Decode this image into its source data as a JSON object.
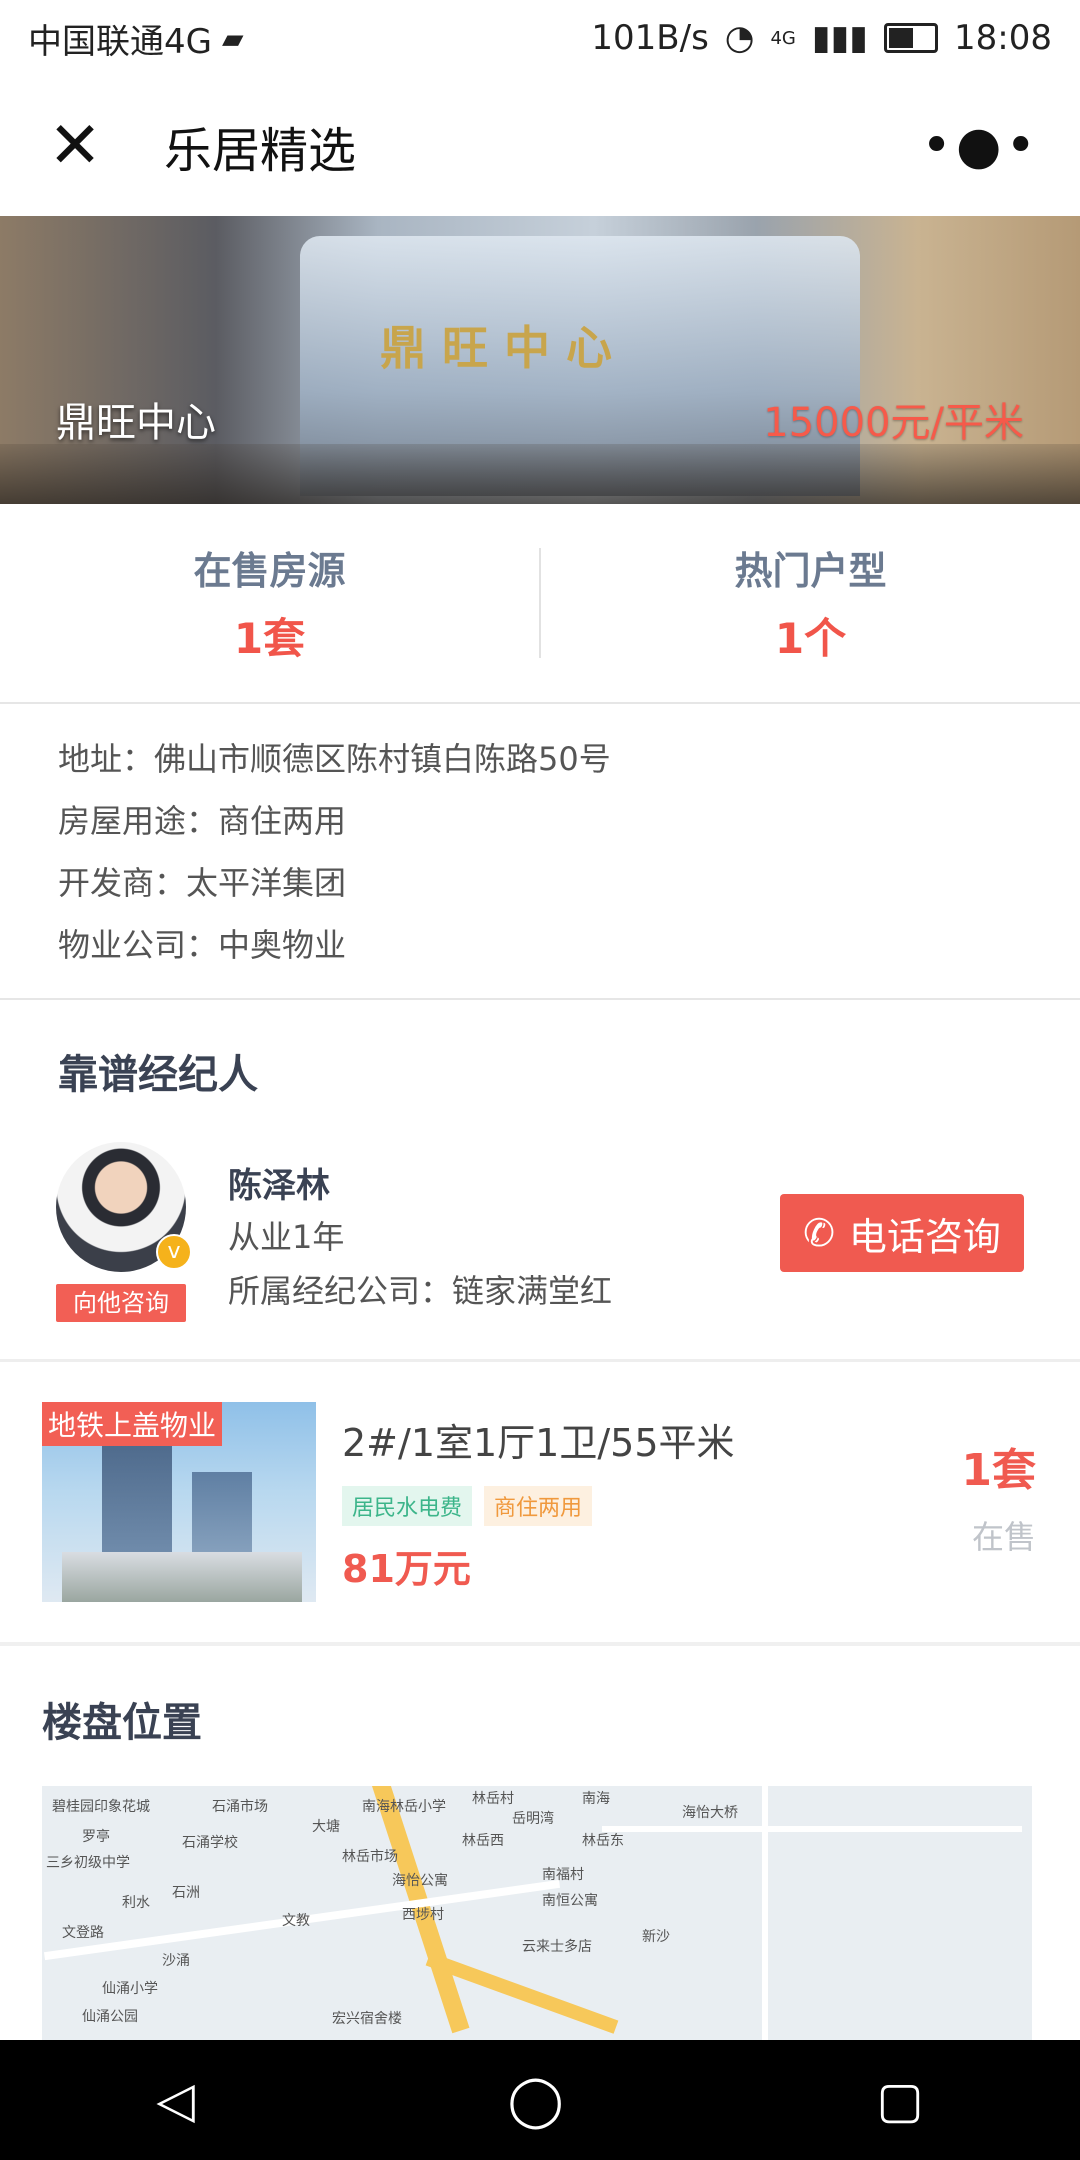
{
  "status": {
    "carrier": "中国联通4G",
    "speed": "101B/s",
    "network": "4G",
    "time": "18:08"
  },
  "nav": {
    "title": "乐居精选"
  },
  "hero": {
    "name": "鼎旺中心",
    "price": "15000元/平米",
    "sign": "鼎旺中心"
  },
  "stats": {
    "onsale_label": "在售房源",
    "onsale_value": "1套",
    "hot_label": "热门户型",
    "hot_value": "1个"
  },
  "info": {
    "address": "地址：佛山市顺德区陈村镇白陈路50号",
    "usage": "房屋用途：商住两用",
    "developer": "开发商：太平洋集团",
    "property": "物业公司：中奥物业"
  },
  "agent": {
    "section_title": "靠谱经纪人",
    "name": "陈泽林",
    "years": "从业1年",
    "company": "所属经纪公司：链家满堂红",
    "consult_tag": "向他咨询",
    "call_label": "电话咨询",
    "verified_mark": "v"
  },
  "listing": {
    "thumb_tag": "地铁上盖物业",
    "title": "2#/1室1厅1卫/55平米",
    "badge1": "居民水电费",
    "badge2": "商住两用",
    "price": "81万元",
    "count": "1套",
    "count_label": "在售"
  },
  "location": {
    "section_title": "楼盘位置",
    "map_labels": [
      "碧桂园印象花城",
      "石涌市场",
      "大塘",
      "南海林岳小学",
      "林岳村",
      "岳明湾",
      "南海",
      "海怡大桥",
      "罗亭",
      "石涌学校",
      "林岳市场",
      "林岳西",
      "林岳东",
      "三乡初级中学",
      "海怡公寓",
      "南福村",
      "利水",
      "石洲",
      "西埗村",
      "南恒公寓",
      "文登路",
      "文教",
      "云来士多店",
      "新沙",
      "仙涌小学",
      "沙涌",
      "仙涌公园",
      "宏兴宿舍楼"
    ]
  },
  "colors": {
    "accent": "#f05a50",
    "label": "#6b7a90"
  }
}
